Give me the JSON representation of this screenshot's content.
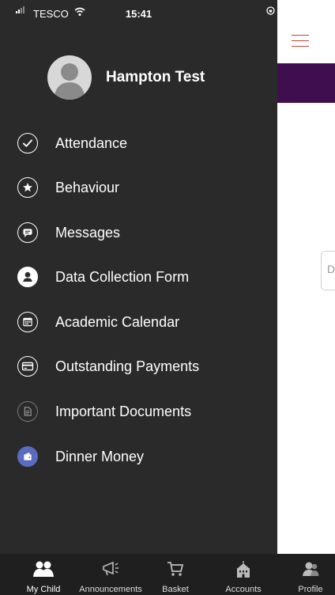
{
  "status_bar": {
    "carrier": "TESCO",
    "time": "15:41"
  },
  "profile": {
    "name": "Hampton Test"
  },
  "menu": [
    {
      "label": "Attendance",
      "icon": "check-circle-icon"
    },
    {
      "label": "Behaviour",
      "icon": "star-circle-icon"
    },
    {
      "label": "Messages",
      "icon": "chat-icon"
    },
    {
      "label": "Data Collection Form",
      "icon": "user-icon"
    },
    {
      "label": "Academic Calendar",
      "icon": "calendar-icon"
    },
    {
      "label": "Outstanding Payments",
      "icon": "credit-card-icon"
    },
    {
      "label": "Important Documents",
      "icon": "document-icon"
    },
    {
      "label": "Dinner Money",
      "icon": "wallet-icon"
    }
  ],
  "tabs": [
    {
      "label": "My Child",
      "icon": "people-icon"
    },
    {
      "label": "Announcements",
      "icon": "megaphone-icon"
    },
    {
      "label": "Basket",
      "icon": "cart-icon"
    },
    {
      "label": "Accounts",
      "icon": "building-icon"
    },
    {
      "label": "Profile",
      "icon": "profile-icon"
    }
  ],
  "background_page": {
    "field_text": "D"
  },
  "colors": {
    "drawer": "#2a2a2a",
    "tabbar": "#1f1f1f",
    "header_bar": "#3f0e4f",
    "hamburger": "#c9423f",
    "accent_blue": "#5b6bbf"
  }
}
